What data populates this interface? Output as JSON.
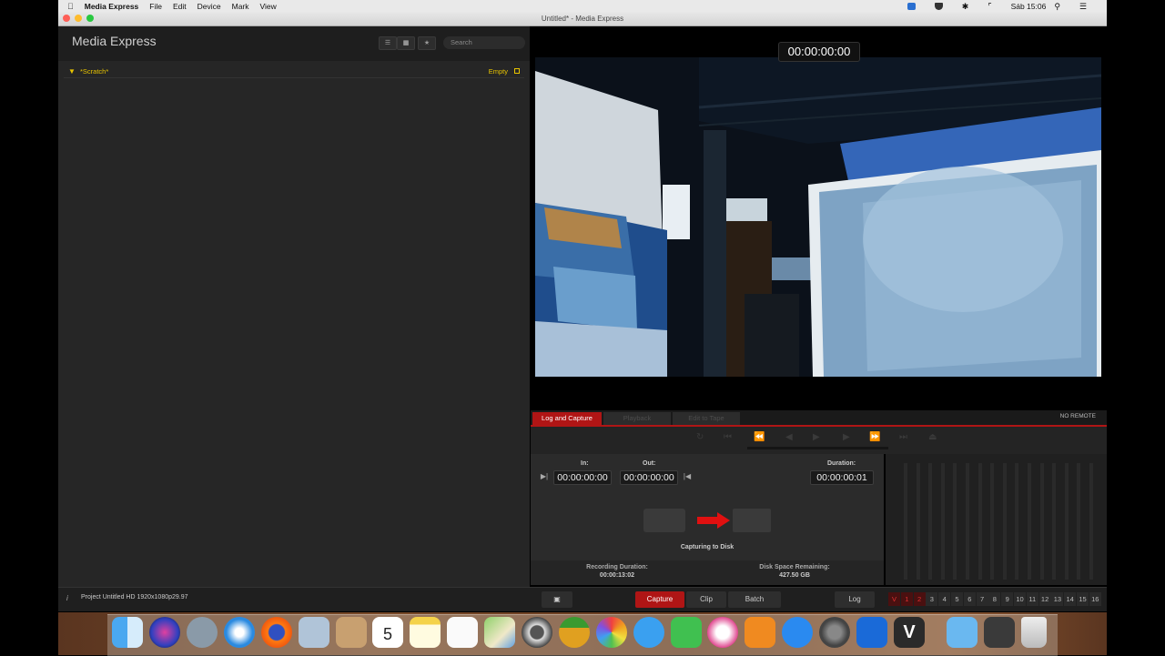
{
  "menubar": {
    "apple": "",
    "app_name": "Media Express",
    "menus": [
      "File",
      "Edit",
      "Device",
      "Mark",
      "View"
    ],
    "clock": "Sáb 15:06"
  },
  "window": {
    "title": "Untitled* - Media Express"
  },
  "library": {
    "title": "Media Express",
    "search_placeholder": "Search",
    "bin_name": "*Scratch*",
    "bin_status": "Empty"
  },
  "viewer": {
    "timecode": "00:00:00:00"
  },
  "tabs": {
    "log_capture": "Log and Capture",
    "playback": "Playback",
    "edit_to_tape": "Edit to Tape",
    "remote_status": "NO REMOTE"
  },
  "log_capture": {
    "in_label": "In:",
    "in_value": "00:00:00:00",
    "out_label": "Out:",
    "out_value": "00:00:00:00",
    "duration_label": "Duration:",
    "duration_value": "00:00:00:01",
    "status": "Capturing to Disk",
    "recording_duration_label": "Recording Duration:",
    "recording_duration_value": "00:00:13:02",
    "disk_space_label": "Disk Space Remaining:",
    "disk_space_value": "427.50 GB"
  },
  "status_bar": {
    "project_info": "Project Untitled  HD 1920x1080p29.97"
  },
  "bottom_buttons": {
    "capture": "Capture",
    "clip": "Clip",
    "batch": "Batch",
    "log": "Log"
  },
  "channels": [
    "V",
    "1",
    "2",
    "3",
    "4",
    "5",
    "6",
    "7",
    "8",
    "9",
    "10",
    "11",
    "12",
    "13",
    "14",
    "15",
    "16"
  ],
  "colors": {
    "accent_red": "#b01515",
    "bin_yellow": "#e8c400"
  }
}
